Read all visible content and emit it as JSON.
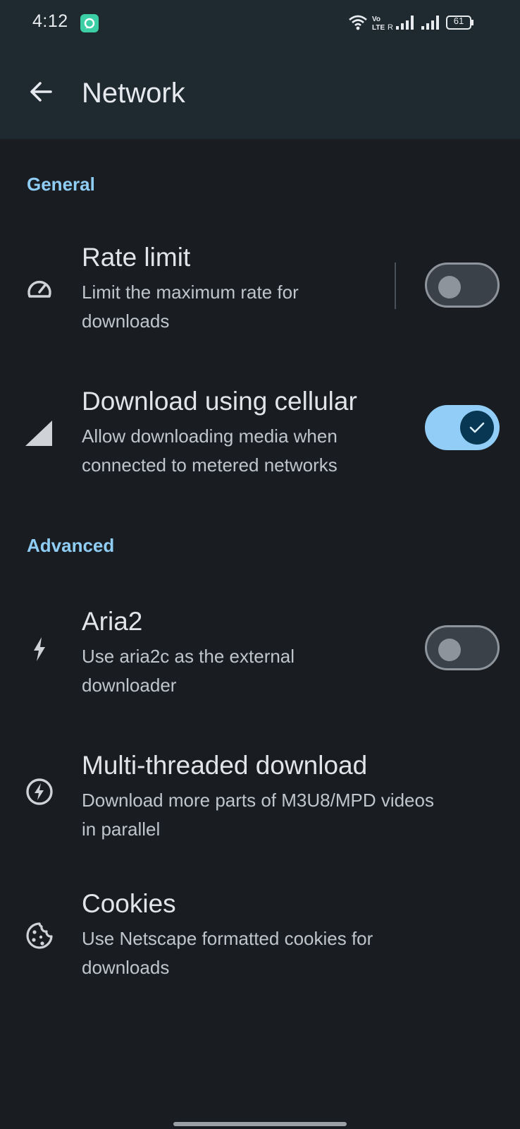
{
  "status_bar": {
    "time": "4:12",
    "battery": "61",
    "volte": "Vo LTE",
    "roaming": "R",
    "icons": [
      "notification-icon",
      "wifi-icon",
      "volte-icon",
      "signal-icon",
      "signal-icon",
      "battery-icon"
    ]
  },
  "app_bar": {
    "title": "Network",
    "back_icon": "arrow-back-icon"
  },
  "sections": {
    "general": {
      "label": "General"
    },
    "advanced": {
      "label": "Advanced"
    }
  },
  "preferences": {
    "rate_limit": {
      "title": "Rate limit",
      "subtitle_line1": "Limit the maximum rate for",
      "subtitle_line2": "downloads",
      "icon": "speedometer-icon",
      "enabled": false
    },
    "cellular": {
      "title": "Download using cellular",
      "subtitle_line1": "Allow downloading media when",
      "subtitle_line2": "connected to metered networks",
      "icon": "cellular-signal-icon",
      "enabled": true
    },
    "aria2": {
      "title": "Aria2",
      "subtitle_line1": "Use aria2c as the external",
      "subtitle_line2": "downloader",
      "icon": "bolt-icon",
      "enabled": false
    },
    "multithread": {
      "title": "Multi-threaded download",
      "subtitle_line1": "Download more parts of M3U8/MPD videos",
      "subtitle_line2": "in parallel",
      "icon": "bolt-circle-icon"
    },
    "cookies": {
      "title": "Cookies",
      "subtitle_line1": "Use Netscape formatted cookies for",
      "subtitle_line2": "downloads",
      "icon": "cookie-icon"
    }
  },
  "colors": {
    "background": "#191c20",
    "app_bar": "#1f2a30",
    "accent": "#8fcdf5",
    "switch_on_track": "#91cdf6",
    "switch_on_thumb": "#073752"
  }
}
